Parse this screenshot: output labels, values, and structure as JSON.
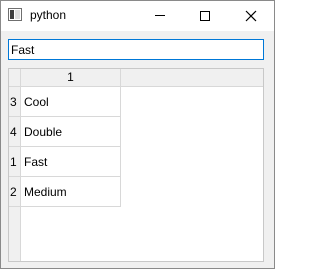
{
  "window": {
    "title": "python",
    "icon": "app-window-icon"
  },
  "search": {
    "value": "Fast"
  },
  "table": {
    "column_headers": [
      "1"
    ],
    "rows": [
      {
        "row_header": "3",
        "value": "Cool"
      },
      {
        "row_header": "4",
        "value": "Double"
      },
      {
        "row_header": "1",
        "value": "Fast"
      },
      {
        "row_header": "2",
        "value": "Medium"
      }
    ]
  }
}
